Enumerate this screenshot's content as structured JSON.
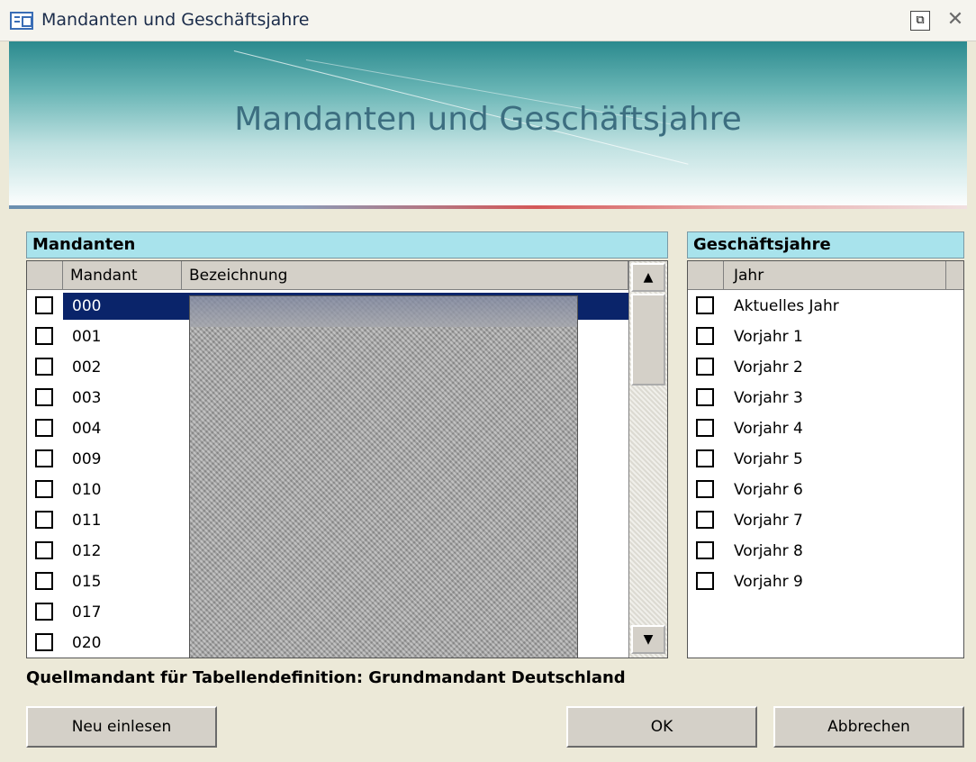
{
  "window": {
    "title": "Mandanten und Geschäftsjahre",
    "restore_glyph": "⧉",
    "close_glyph": "✕"
  },
  "banner": {
    "title": "Mandanten und Geschäftsjahre"
  },
  "mandanten": {
    "section_label": "Mandanten",
    "columns": [
      "Mandant",
      "Bezeichnung"
    ],
    "rows": [
      {
        "mandant": "000",
        "selected": true
      },
      {
        "mandant": "001",
        "selected": false
      },
      {
        "mandant": "002",
        "selected": false
      },
      {
        "mandant": "003",
        "selected": false
      },
      {
        "mandant": "004",
        "selected": false
      },
      {
        "mandant": "009",
        "selected": false
      },
      {
        "mandant": "010",
        "selected": false
      },
      {
        "mandant": "011",
        "selected": false
      },
      {
        "mandant": "012",
        "selected": false
      },
      {
        "mandant": "015",
        "selected": false
      },
      {
        "mandant": "017",
        "selected": false
      },
      {
        "mandant": "020",
        "selected": false
      }
    ],
    "scroll_up_glyph": "▲",
    "scroll_down_glyph": "▼"
  },
  "geschaeftsjahre": {
    "section_label": "Geschäftsjahre",
    "column": "Jahr",
    "rows": [
      "Aktuelles Jahr",
      "Vorjahr 1",
      "Vorjahr 2",
      "Vorjahr 3",
      "Vorjahr 4",
      "Vorjahr 5",
      "Vorjahr 6",
      "Vorjahr 7",
      "Vorjahr 8",
      "Vorjahr 9"
    ]
  },
  "source_line": "Quellmandant für Tabellendefinition:  Grundmandant Deutschland",
  "buttons": {
    "reload": "Neu einlesen",
    "ok": "OK",
    "cancel": "Abbrechen"
  },
  "colors": {
    "section_header_bg": "#a8e3ec",
    "selection_bg": "#0a246a",
    "banner_title": "#3c6e80"
  }
}
